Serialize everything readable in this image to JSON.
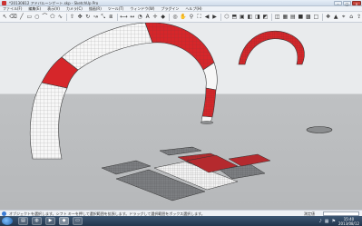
{
  "window": {
    "title": "*20130812 アドバルーンゲート.skp - SketchUp Pro",
    "minimize_icon": "minimize-icon",
    "maximize_icon": "maximize-icon",
    "close_icon": "close-icon"
  },
  "menu": [
    {
      "label": "ファイル(F)"
    },
    {
      "label": "編集(E)"
    },
    {
      "label": "表示(V)"
    },
    {
      "label": "カメラ(C)"
    },
    {
      "label": "描画(R)"
    },
    {
      "label": "ツール(T)"
    },
    {
      "label": "ウィンドウ(W)"
    },
    {
      "label": "プラグイン"
    },
    {
      "label": "ヘルプ(H)"
    }
  ],
  "toolbar": {
    "tools": [
      {
        "icon": "select-arrow-icon",
        "glyph": "↖"
      },
      {
        "icon": "eraser-icon",
        "glyph": "⌫"
      },
      {
        "icon": "pencil-line-icon",
        "glyph": "╱"
      },
      {
        "icon": "rectangle-icon",
        "glyph": "▭"
      },
      {
        "icon": "circle-icon",
        "glyph": "○"
      },
      {
        "icon": "arc-icon",
        "glyph": "⌒"
      },
      {
        "icon": "polygon-icon",
        "glyph": "⬠"
      },
      {
        "icon": "freehand-icon",
        "glyph": "∿"
      },
      {
        "icon": "push-pull-icon",
        "glyph": "⇧"
      },
      {
        "icon": "move-icon",
        "glyph": "✥"
      },
      {
        "icon": "rotate-icon",
        "glyph": "↻"
      },
      {
        "icon": "follow-me-icon",
        "glyph": "↝"
      },
      {
        "icon": "scale-icon",
        "glyph": "⤡"
      },
      {
        "icon": "offset-icon",
        "glyph": "⧈"
      },
      {
        "icon": "tape-measure-icon",
        "glyph": "⟷"
      },
      {
        "icon": "dimension-icon",
        "glyph": "↔"
      },
      {
        "icon": "protractor-icon",
        "glyph": "◔"
      },
      {
        "icon": "text-icon",
        "glyph": "A"
      },
      {
        "icon": "axes-icon",
        "glyph": "✛"
      },
      {
        "icon": "paint-bucket-icon",
        "glyph": "◆"
      },
      {
        "icon": "orbit-icon",
        "glyph": "◎"
      },
      {
        "icon": "pan-icon",
        "glyph": "✋"
      },
      {
        "icon": "zoom-icon",
        "glyph": "⚲"
      },
      {
        "icon": "zoom-extents-icon",
        "glyph": "⛶"
      },
      {
        "icon": "previous-view-icon",
        "glyph": "◀"
      },
      {
        "icon": "next-view-icon",
        "glyph": "▶"
      },
      {
        "icon": "iso-view-icon",
        "glyph": "⬡"
      },
      {
        "icon": "top-view-icon",
        "glyph": "⬒"
      },
      {
        "icon": "front-view-icon",
        "glyph": "▣"
      },
      {
        "icon": "right-view-icon",
        "glyph": "◧"
      },
      {
        "icon": "back-view-icon",
        "glyph": "◨"
      },
      {
        "icon": "left-view-icon",
        "glyph": "◩"
      },
      {
        "icon": "xray-icon",
        "glyph": "◫"
      },
      {
        "icon": "wireframe-icon",
        "glyph": "▦"
      },
      {
        "icon": "hidden-line-icon",
        "glyph": "▤"
      },
      {
        "icon": "shaded-icon",
        "glyph": "■"
      },
      {
        "icon": "textured-icon",
        "glyph": "▩"
      },
      {
        "icon": "monochrome-icon",
        "glyph": "□"
      },
      {
        "icon": "component-icon",
        "glyph": "❖"
      },
      {
        "icon": "sandbox-icon",
        "glyph": "▲"
      },
      {
        "icon": "geo-location-icon",
        "glyph": "⌖"
      },
      {
        "icon": "warehouse-icon",
        "glyph": "⌂"
      },
      {
        "icon": "share-icon",
        "glyph": "⇪"
      }
    ]
  },
  "viewport": {
    "sky_color": "#e9ebed",
    "ground_color": "#bcbec0",
    "scene": {
      "arch_main": {
        "colors": [
          "#d6262a",
          "#ffffff"
        ]
      },
      "arch_far": {
        "colors": [
          "#d6262a"
        ]
      },
      "mats": {
        "colors": [
          "#7d7f82",
          "#b52a2e",
          "#f4f4f4"
        ]
      }
    }
  },
  "status": {
    "hint_icon": "info-icon",
    "hint_text": "オブジェクトを選択します。シフト キーを押して選択範囲を拡張します。ドラッグして選択範囲をボックス選択します。",
    "measure_label": "測定値"
  },
  "taskbar": {
    "start_icon": "windows-start-icon",
    "items": [
      {
        "icon": "explorer-icon",
        "glyph": "▤"
      },
      {
        "icon": "browser-icon",
        "glyph": "◍"
      },
      {
        "icon": "media-icon",
        "glyph": "▶"
      },
      {
        "icon": "sketchup-icon",
        "glyph": "◆"
      },
      {
        "icon": "folder-icon",
        "glyph": "▭"
      }
    ],
    "tray": [
      {
        "icon": "speaker-icon",
        "glyph": "♪"
      },
      {
        "icon": "network-icon",
        "glyph": "▦"
      },
      {
        "icon": "flag-icon",
        "glyph": "⚑"
      }
    ],
    "time": "15:40",
    "date": "2013/08/12"
  }
}
